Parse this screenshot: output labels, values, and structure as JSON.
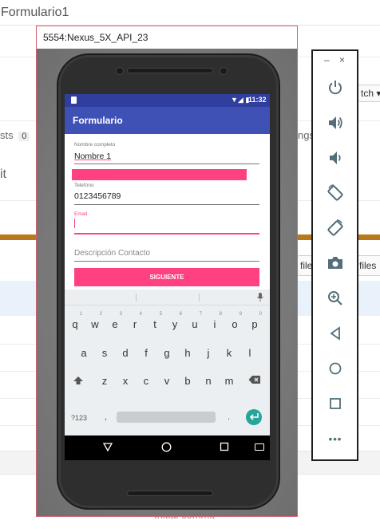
{
  "background_app": {
    "title": "Formulario1",
    "tab_counter_label": "sts",
    "tab_counter_value": "0",
    "left_snippet": "it",
    "branch_button": "tch",
    "mid_right_text": "ngs",
    "files_button_1": "file",
    "files_button_2": "l files",
    "commit_message": "Initial commit"
  },
  "emulator": {
    "window_title": "5554:Nexus_5X_API_23",
    "status_bar": {
      "time": "11:32",
      "signal": "▼◢ ▮"
    },
    "app_bar_title": "Formulario",
    "form": {
      "name_label": "Nombre completo",
      "name_value": "Nombre 1",
      "phone_label": "Telefono",
      "phone_value": "0123456789",
      "email_label": "Email",
      "email_value": "",
      "description_placeholder": "Descripción Contacto",
      "submit_label": "SIGUIENTE"
    },
    "keyboard": {
      "row1": [
        "q",
        "w",
        "e",
        "r",
        "t",
        "y",
        "u",
        "i",
        "o",
        "p"
      ],
      "row1_hints": [
        "1",
        "2",
        "3",
        "4",
        "5",
        "6",
        "7",
        "8",
        "9",
        "0"
      ],
      "row2": [
        "a",
        "s",
        "d",
        "f",
        "g",
        "h",
        "j",
        "k",
        "l"
      ],
      "row3": [
        "z",
        "x",
        "c",
        "v",
        "b",
        "n",
        "m"
      ],
      "symbols_key": "?123",
      "comma_key": ",",
      "period_key": "."
    },
    "toolbar": {
      "minimize": "–",
      "close": "×",
      "buttons": [
        "power-icon",
        "volume-up-icon",
        "volume-down-icon",
        "rotate-left-icon",
        "rotate-right-icon",
        "camera-icon",
        "zoom-icon",
        "back-icon",
        "home-icon",
        "overview-icon",
        "more-icon"
      ],
      "more_glyph": "•••"
    }
  },
  "colors": {
    "primary": "#3f51b5",
    "primary_dark": "#303f9f",
    "accent": "#ff4081",
    "toolbar_icon": "#546e7a"
  }
}
